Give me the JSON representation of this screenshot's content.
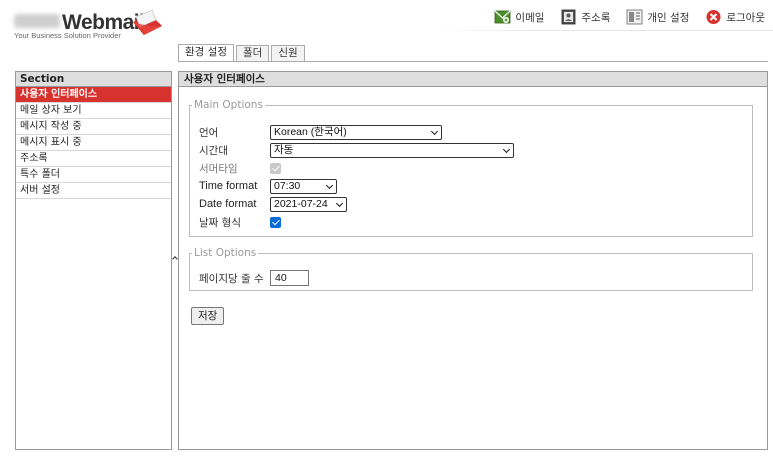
{
  "logo": {
    "text": "Webmail",
    "tagline": "Your Business Solution Provider"
  },
  "topnav": [
    {
      "label": "이메일",
      "icon": "email-icon"
    },
    {
      "label": "주소록",
      "icon": "addressbook-icon"
    },
    {
      "label": "개인 설정",
      "icon": "settings-icon"
    },
    {
      "label": "로그아웃",
      "icon": "logout-icon"
    }
  ],
  "tabs": [
    "환경 설정",
    "폴더",
    "신원"
  ],
  "left": {
    "header": "Section",
    "items": [
      "사용자 인터페이스",
      "메일 상자 보기",
      "메시지 작성 중",
      "메시지 표시 중",
      "주소록",
      "특수 폴더",
      "서버 설정"
    ]
  },
  "right": {
    "header": "사용자 인터페이스",
    "main": {
      "legend": "Main Options",
      "language_label": "언어",
      "language_value": "Korean (한국어)",
      "timezone_label": "시간대",
      "timezone_value": "자동",
      "summertime_label": "서머타임",
      "summertime_checked": true,
      "summertime_disabled": true,
      "timeformat_label": "Time format",
      "timeformat_value": "07:30",
      "dateformat_label": "Date format",
      "dateformat_value": "2021-07-24",
      "prettydate_label": "날짜 형식",
      "prettydate_checked": true
    },
    "list": {
      "legend": "List Options",
      "rows_label": "페이지당 줄 수",
      "rows_value": "40"
    },
    "save_label": "저장"
  },
  "colors": {
    "accent": "#d8322e",
    "checkbox": "#0a6ad8",
    "panel_header": "#dedede"
  }
}
